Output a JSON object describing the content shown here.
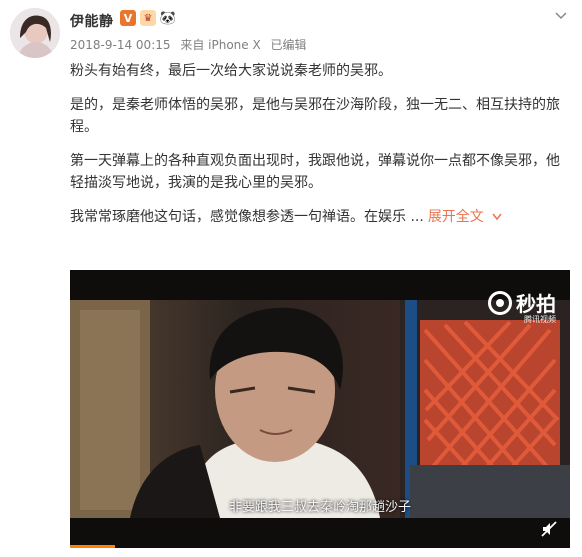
{
  "post": {
    "username": "伊能静",
    "meta": {
      "date": "2018-9-14 00:15",
      "source": "来自 iPhone X",
      "edited": "已编辑"
    },
    "paragraphs": [
      "粉头有始有终，最后一次给大家说说秦老师的吴邪。",
      "是的，是秦老师体悟的吴邪，是他与吴邪在沙海阶段，独一无二、相互扶持的旅程。",
      "第一天弹幕上的各种直观负面出现时，我跟他说，弹幕说你一点都不像吴邪，他轻描淡写地说，我演的是我心里的吴邪。",
      "我常常琢磨他这句话，感觉像想参透一句禅语。在娱乐 ..."
    ],
    "expand_label": "展开全文",
    "expand_icon": "chevron-down-icon"
  },
  "video": {
    "subtitle": "非要跟我三叔去秦岭淘那趟沙子",
    "watermark": "秒拍",
    "watermark_sub": "腾讯视频",
    "progress": 0.09
  },
  "colors": {
    "accent": "#eb7350",
    "meta": "#808080",
    "text": "#333333",
    "progress": "#ff8200"
  }
}
